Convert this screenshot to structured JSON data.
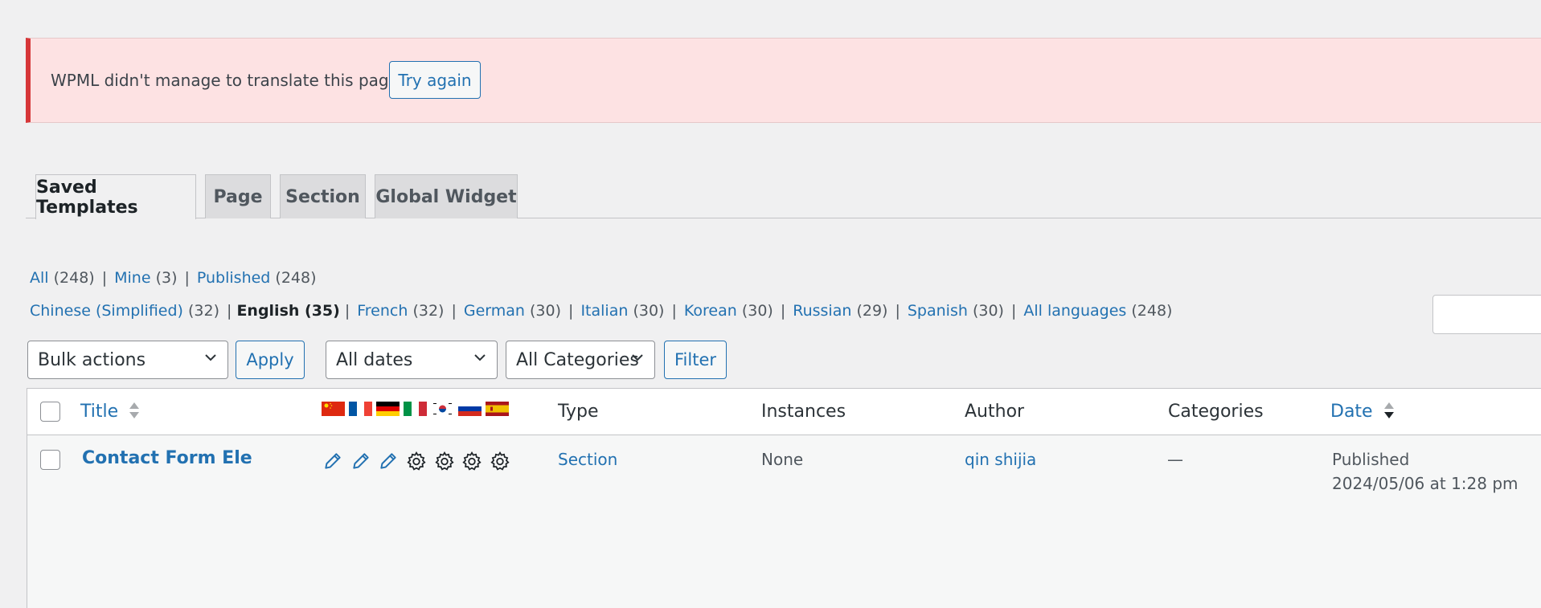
{
  "notice": {
    "message": "WPML didn't manage to translate this page.",
    "button": "Try again"
  },
  "tabs": [
    {
      "label": "Saved Templates",
      "active": true
    },
    {
      "label": "Page"
    },
    {
      "label": "Section"
    },
    {
      "label": "Global Widget"
    }
  ],
  "status_filters": {
    "all": {
      "label": "All",
      "count": "(248)"
    },
    "mine": {
      "label": "Mine",
      "count": "(3)"
    },
    "published": {
      "label": "Published",
      "count": "(248)"
    }
  },
  "language_filters": {
    "chinese": {
      "label": "Chinese (Simplified)",
      "count": "(32)"
    },
    "english": {
      "label": "English (35)"
    },
    "french": {
      "label": "French",
      "count": "(32)"
    },
    "german": {
      "label": "German",
      "count": "(30)"
    },
    "italian": {
      "label": "Italian",
      "count": "(30)"
    },
    "korean": {
      "label": "Korean",
      "count": "(30)"
    },
    "russian": {
      "label": "Russian",
      "count": "(29)"
    },
    "spanish": {
      "label": "Spanish",
      "count": "(30)"
    },
    "all_languages": {
      "label": "All languages",
      "count": "(248)"
    }
  },
  "controls": {
    "bulk_actions": "Bulk actions",
    "apply": "Apply",
    "dates": "All dates",
    "categories": "All Categories",
    "filter": "Filter"
  },
  "table": {
    "columns": {
      "title": "Title",
      "type": "Type",
      "instances": "Instances",
      "author": "Author",
      "categories": "Categories",
      "date": "Date"
    },
    "flags": [
      "china-flag-icon",
      "france-flag-icon",
      "germany-flag-icon",
      "italy-flag-icon",
      "korea-flag-icon",
      "russia-flag-icon",
      "spain-flag-icon"
    ],
    "rows": [
      {
        "title": "Contact Form Ele",
        "translation_icons": [
          "pencil-icon",
          "pencil-icon",
          "pencil-icon",
          "gear-icon",
          "gear-icon",
          "gear-icon",
          "gear-icon"
        ],
        "type": "Section",
        "instances": "None",
        "author": "qin shijia",
        "categories": "—",
        "status": "Published",
        "date": "2024/05/06 at 1:28 pm"
      }
    ]
  },
  "colors": {
    "link": "#2271b1",
    "notice_bg": "#fde2e3",
    "notice_border": "#d63638"
  }
}
